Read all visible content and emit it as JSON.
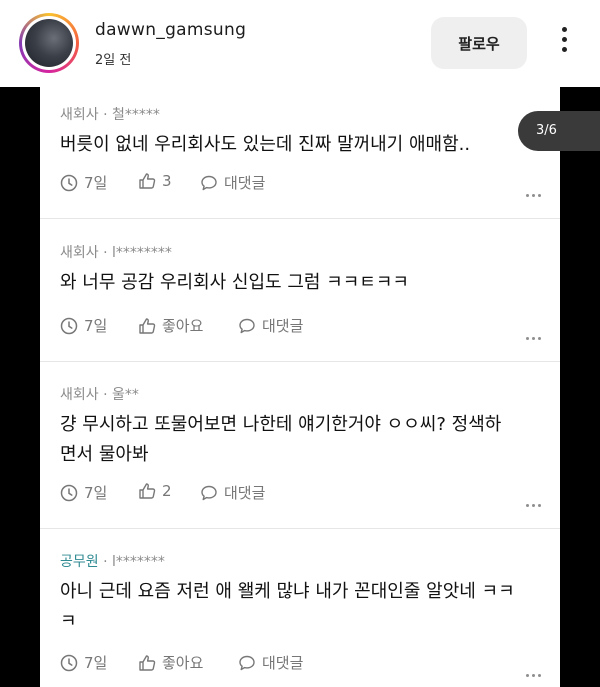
{
  "header": {
    "username": "dawwn_gamsung",
    "time_ago": "2일 전",
    "follow_label": "팔로우"
  },
  "pager": {
    "label": "3/6"
  },
  "comments": [
    {
      "company": "새회사",
      "author": "· 철*****",
      "text_lines": [
        "버릇이 없네 우리회사도 있는데 진짜 말꺼내기 애매함.."
      ],
      "days": "7일",
      "likes": "3",
      "reply": "대댓글"
    },
    {
      "company": "새회사",
      "author": "· l********",
      "text_lines": [
        "와 너무 공감 우리회사 신입도 그럼 ㅋㅋㅌㅋㅋ"
      ],
      "days": "7일",
      "likes": "좋아요",
      "reply": "대댓글"
    },
    {
      "company": "새회사",
      "author": "· 울**",
      "text_lines": [
        "걍 무시하고 또물어보면 나한테 얘기한거야 ㅇㅇ씨? 정색하",
        "면서 물아봐"
      ],
      "days": "7일",
      "likes": "2",
      "reply": "대댓글"
    },
    {
      "company": "공무원",
      "author": "· l*******",
      "text_lines": [
        "아니 근데 요즘 저런 애 왤케 많냐 내가 꼰대인줄 알앗네 ㅋㅋ",
        "ㅋ"
      ],
      "days": "7일",
      "likes": "좋아요",
      "reply": "대댓글"
    }
  ]
}
